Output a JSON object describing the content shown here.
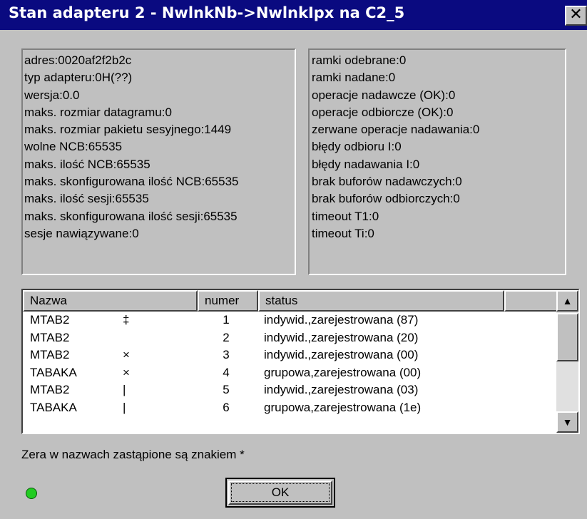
{
  "window": {
    "title": "Stan adapteru 2 - NwlnkNb->NwlnkIpx na C2_5",
    "close_glyph": "✕"
  },
  "adapter_info": [
    "adres:0020af2f2b2c",
    "typ adapteru:0H(??)",
    "wersja:0.0",
    "maks. rozmiar datagramu:0",
    "maks. rozmiar pakietu sesyjnego:1449",
    "wolne NCB:65535",
    "maks. ilość NCB:65535",
    "maks. skonfigurowana ilość NCB:65535",
    "maks. ilość sesji:65535",
    "maks. skonfigurowana ilość sesji:65535",
    "sesje nawiązywane:0"
  ],
  "frame_stats": [
    "ramki odebrane:0",
    "ramki nadane:0",
    "operacje nadawcze (OK):0",
    "operacje odbiorcze (OK):0",
    "zerwane operacje nadawania:0",
    "błędy odbioru I:0",
    "błędy nadawania I:0",
    "brak buforów nadawczych:0",
    "brak buforów odbiorczych:0",
    "timeout T1:0",
    "timeout Ti:0"
  ],
  "names_table": {
    "columns": [
      "Nazwa",
      "numer",
      "status"
    ],
    "rows": [
      {
        "name": "MTAB2",
        "mark": "‡",
        "number": "1",
        "status": "indywid.,zarejestrowana (87)"
      },
      {
        "name": "MTAB2",
        "mark": "",
        "number": "2",
        "status": "indywid.,zarejestrowana (20)"
      },
      {
        "name": "MTAB2",
        "mark": "×",
        "number": "3",
        "status": "indywid.,zarejestrowana (00)"
      },
      {
        "name": "TABAKA",
        "mark": "×",
        "number": "4",
        "status": "grupowa,zarejestrowana (00)"
      },
      {
        "name": "MTAB2",
        "mark": "|",
        "number": "5",
        "status": "indywid.,zarejestrowana (03)"
      },
      {
        "name": "TABAKA",
        "mark": "|",
        "number": "6",
        "status": "grupowa,zarejestrowana (1e)"
      }
    ]
  },
  "note": "Zera w nazwach zastąpione są znakiem *",
  "status_led_color": "#22cc22",
  "ok_label": "OK"
}
